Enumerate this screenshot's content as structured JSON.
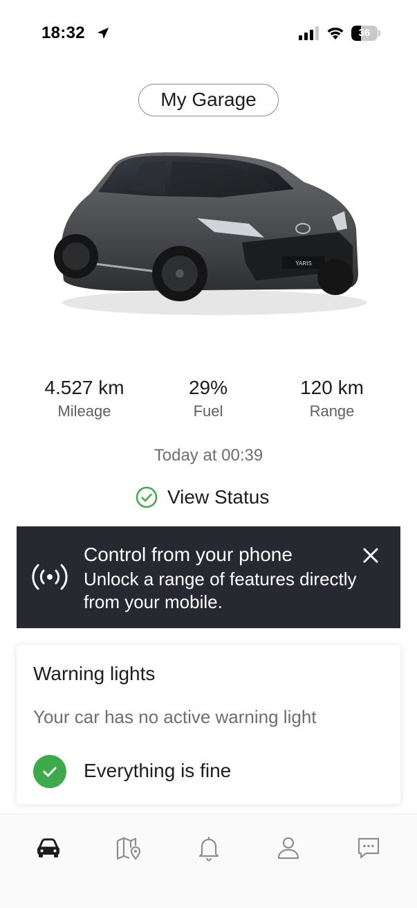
{
  "status_bar": {
    "time": "18:32",
    "battery": "36",
    "battery_level": 0.36
  },
  "garage": {
    "label": "My Garage"
  },
  "car": {
    "badge": "YARIS",
    "image": "car-image"
  },
  "stats": [
    {
      "value": "4.527 km",
      "label": "Mileage"
    },
    {
      "value": "29%",
      "label": "Fuel"
    },
    {
      "value": "120 km",
      "label": "Range"
    }
  ],
  "updated": "Today at 00:39",
  "view_status": {
    "label": "View Status",
    "icon": "check-circle-outline-icon",
    "icon_color": "#3daa4c"
  },
  "banner": {
    "title": "Control from your phone",
    "text": "Unlock a range of features directly from your mobile.",
    "icon": "remote-signal-icon",
    "close_icon": "close-icon",
    "background": "#282830"
  },
  "warning_card": {
    "title": "Warning lights",
    "subtitle": "Your car has no active warning light",
    "status": "Everything is fine",
    "status_icon": "check-circle-filled-icon",
    "status_color": "#3daa4c"
  },
  "bottom_nav": {
    "items": [
      {
        "name": "car",
        "icon": "car-icon",
        "active": true
      },
      {
        "name": "map",
        "icon": "map-pin-icon",
        "active": false
      },
      {
        "name": "notifications",
        "icon": "bell-icon",
        "active": false
      },
      {
        "name": "profile",
        "icon": "user-icon",
        "active": false
      },
      {
        "name": "messages",
        "icon": "chat-icon",
        "active": false
      }
    ]
  }
}
